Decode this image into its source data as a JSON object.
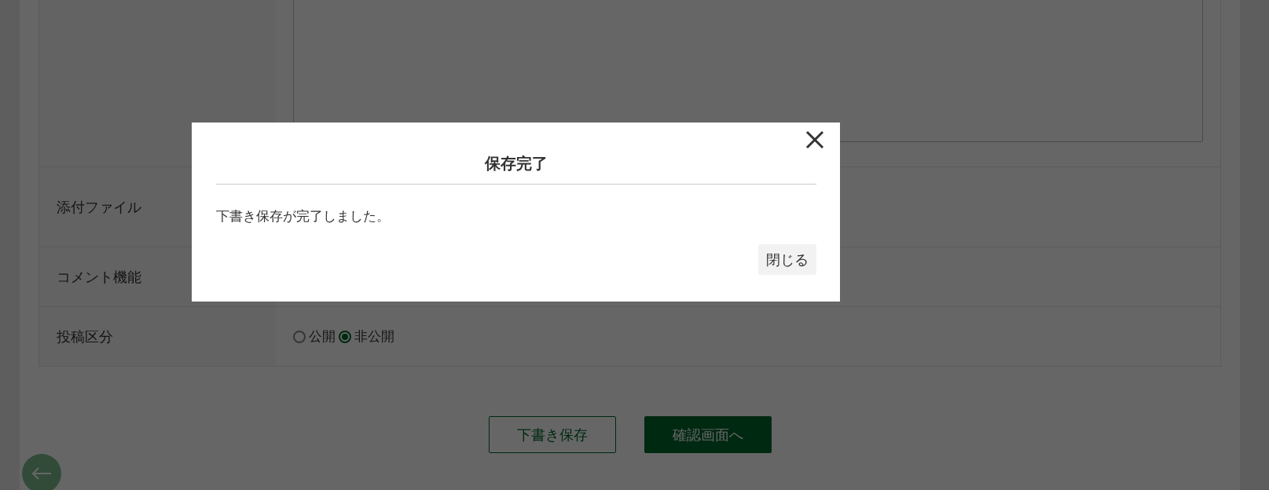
{
  "form": {
    "rows": [
      {
        "kind": "textarea",
        "label": ""
      },
      {
        "kind": "blank",
        "label": "添付ファイル"
      },
      {
        "kind": "blank",
        "label": "コメント機能"
      },
      {
        "kind": "radio",
        "label": "投稿区分",
        "options": [
          {
            "label": "公開",
            "selected": false
          },
          {
            "label": "非公開",
            "selected": true
          }
        ]
      }
    ]
  },
  "buttons": [
    {
      "kind": "outline",
      "label": "下書き保存"
    },
    {
      "kind": "primary",
      "label": "確認画面へ"
    }
  ],
  "modal": {
    "title": "保存完了",
    "message": "下書き保存が完了しました。",
    "close_button": "閉じる"
  }
}
